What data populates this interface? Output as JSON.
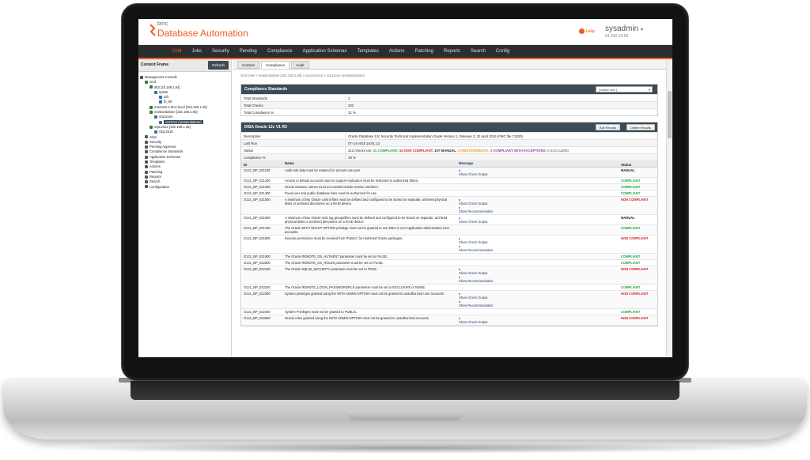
{
  "header": {
    "brand": "bmc",
    "product": "Database Automation",
    "help": "Help",
    "user": "sysadmin",
    "ip": "54.200.29.58"
  },
  "nav": [
    "Grid",
    "Jobs",
    "Security",
    "Pending",
    "Compliance",
    "Application Schemas",
    "Templates",
    "Actions",
    "Patching",
    "Reports",
    "Search",
    "Config"
  ],
  "left": {
    "title": "Context Frame",
    "refresh": "Refresh",
    "tree": [
      {
        "label": "Management Console",
        "indent": 0,
        "color": "#555"
      },
      {
        "label": "Grid",
        "indent": 1,
        "color": "#2f7d32"
      },
      {
        "label": "db2 [10.168.1.54]",
        "indent": 2,
        "color": "#2f7d32"
      },
      {
        "label": "sys96",
        "indent": 3,
        "color": "#3b6ea5"
      },
      {
        "label": "tuft",
        "indent": 4,
        "color": "#3b6ea5"
      },
      {
        "label": "t0_99",
        "indent": 4,
        "color": "#3b6ea5"
      },
      {
        "label": "oraclustr-1.bmc.local [192.168.1.20]",
        "indent": 2,
        "color": "#2f7d32"
      },
      {
        "label": "orastandalone [192.168.1.55]",
        "indent": 2,
        "color": "#2f7d32"
      },
      {
        "label": "ora12cee",
        "indent": 3,
        "color": "#3b6ea5"
      },
      {
        "label": "ora12ce (orastandalone)",
        "indent": 4,
        "color": "#3b6ea5",
        "selected": true
      },
      {
        "label": "SQL2012 [192.168.1.45]",
        "indent": 2,
        "color": "#2f7d32"
      },
      {
        "label": "SQL2016",
        "indent": 3,
        "color": "#3b6ea5"
      },
      {
        "label": "Jobs",
        "indent": 1,
        "color": "#555"
      },
      {
        "label": "Security",
        "indent": 1,
        "color": "#555"
      },
      {
        "label": "Pending Approval",
        "indent": 1,
        "color": "#555"
      },
      {
        "label": "Compliance Standards",
        "indent": 1,
        "color": "#555"
      },
      {
        "label": "Application Schemas",
        "indent": 1,
        "color": "#555"
      },
      {
        "label": "Templates",
        "indent": 1,
        "color": "#555"
      },
      {
        "label": "Actions",
        "indent": 1,
        "color": "#555"
      },
      {
        "label": "Patching",
        "indent": 1,
        "color": "#555"
      },
      {
        "label": "Reports",
        "indent": 1,
        "color": "#555"
      },
      {
        "label": "Search",
        "indent": 1,
        "color": "#555"
      },
      {
        "label": "Configuration",
        "indent": 1,
        "color": "#555"
      }
    ]
  },
  "tabs": [
    "Context",
    "Compliance",
    "Audit"
  ],
  "breadcrumb": "Grid View > orastandalone [192.168.1.55] > ora12cee12 > ora12cee (orastandalone)",
  "standards": {
    "title": "Compliance Standards",
    "select": "[ select one ]",
    "rows": [
      {
        "k": "Total Standards",
        "v": "2"
      },
      {
        "k": "Total Checks",
        "v": "232"
      },
      {
        "k": "Total Compliance %",
        "v": "21 %"
      }
    ]
  },
  "disa": {
    "title": "DISA Oracle 12c V1 R3",
    "edit": "Edit Results",
    "delete": "Delete Results",
    "description": "Oracle Database 12c Security Technical Implementation Guide Version 1, Release 3, 22 April 2016 (FMC file 71200)",
    "last_run": "07-14-2016 15:51:13",
    "status_prefix": "212 checks ran:",
    "status_parts": [
      {
        "text": "41 COMPLIANT,",
        "cls": "ok"
      },
      {
        "text": "54 NON COMPLIANT,",
        "cls": "bad"
      },
      {
        "text": "107 MANUAL,",
        "cls": "ink"
      },
      {
        "text": "0 INDETERMINATE,",
        "cls": "ind"
      },
      {
        "text": "0 COMPLIANT WITH EXCEPTIONS,",
        "cls": "exc"
      },
      {
        "text": "0 EXCLUDED",
        "cls": "excl"
      }
    ],
    "compliance": "19 %",
    "labels": {
      "description": "Description",
      "last_run": "Last Run",
      "status": "Status",
      "compliance": "Compliance %"
    }
  },
  "table": {
    "headers": [
      "ID",
      "Name",
      "Message",
      "Status"
    ],
    "rows": [
      {
        "id": "O121_BP_021100",
        "name": "Audit trail data must be retained for at least one year.",
        "msg": [
          "Show Check Output"
        ],
        "status": "MANUAL"
      },
      {
        "id": "O121_BP_021200",
        "name": "Access to default accounts used to support replication must be restricted to authorized DBAs.",
        "msg": [],
        "status": "COMPLIANT"
      },
      {
        "id": "O121_BP_021300",
        "name": "Oracle instance names must not contain Oracle version numbers.",
        "msg": [],
        "status": "COMPLIANT"
      },
      {
        "id": "O121_BP_021400",
        "name": "Fixed user and public database links must be authorized for use.",
        "msg": [],
        "status": "COMPLIANT"
      },
      {
        "id": "O121_BP_021500",
        "name": "A minimum of two Oracle control files must be defined and configured to be stored on separate, archived physical disks or archived directories on a RAID device.",
        "msg": [
          "Show Check Output",
          "Show Recommendation"
        ],
        "status": "NON COMPLIANT"
      },
      {
        "id": "O121_BP_021600",
        "name": "A minimum of two Oracle redo log groups/files must be defined and configured to be stored on separate, archived physical disks or archived directories on a RAID device.",
        "msg": [
          "Show Check Output"
        ],
        "status": "MANUAL"
      },
      {
        "id": "O121_BP_021700",
        "name": "The Oracle WITH GRANT OPTION privilege must not be granted to non-DBA or non-Application administrator user accounts.",
        "msg": [],
        "status": "COMPLIANT"
      },
      {
        "id": "O121_BP_021800",
        "name": "Execute permission must be revoked from PUBLIC for restricted Oracle packages.",
        "msg": [
          "Show Check Output",
          "Show Recommendation"
        ],
        "status": "NON COMPLIANT"
      },
      {
        "id": "O121_BP_021900",
        "name": "The Oracle REMOTE_OS_AUTHENT parameter must be set to FALSE.",
        "msg": [],
        "status": "COMPLIANT"
      },
      {
        "id": "O121_BP_022000",
        "name": "The Oracle REMOTE_OS_ROLES parameter must be set to FALSE.",
        "msg": [],
        "status": "COMPLIANT"
      },
      {
        "id": "O121_BP_022100",
        "name": "The Oracle SQL92_SECURITY parameter must be set to TRUE.",
        "msg": [
          "Show Check Output",
          "Show Recommendation"
        ],
        "status": "NON COMPLIANT"
      },
      {
        "id": "O121_BP_022200",
        "name": "The Oracle REMOTE_LOGIN_PASSWORDFILE parameter must be set to EXCLUSIVE or NONE.",
        "msg": [],
        "status": "COMPLIANT"
      },
      {
        "id": "O121_BP_022300",
        "name": "System privileges granted using the WITH ADMIN OPTION must not be granted to unauthorized user accounts.",
        "msg": [
          "Show Check Output",
          "Show Recommendation"
        ],
        "status": "NON COMPLIANT"
      },
      {
        "id": "O121_BP_022400",
        "name": "System Privileges must not be granted to PUBLIC.",
        "msg": [],
        "status": "COMPLIANT"
      },
      {
        "id": "O121_BP_022500",
        "name": "Oracle roles granted using the WITH ADMIN OPTION must not be granted to unauthorized accounts.",
        "msg": [
          "Show Check Output"
        ],
        "status": "NON COMPLIANT"
      }
    ]
  },
  "colors": {
    "accent": "#f15a22",
    "panel_header": "#3b4b57",
    "compliant": "#1fa33a",
    "non_compliant": "#d11f1f"
  }
}
